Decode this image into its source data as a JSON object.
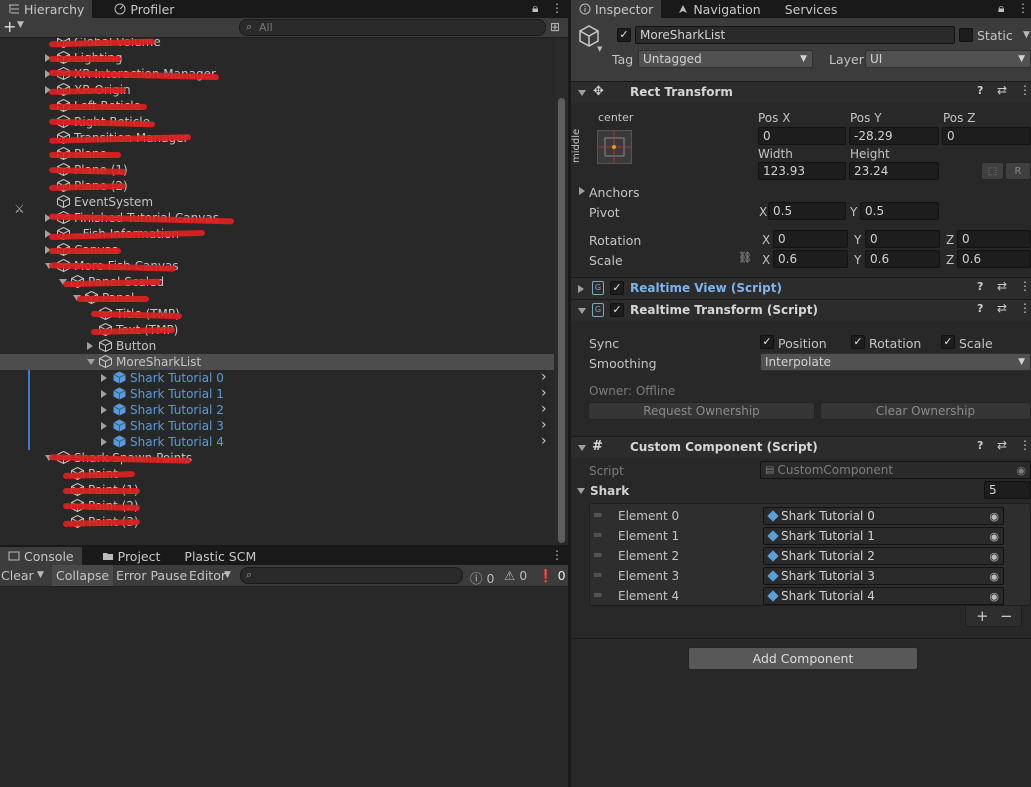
{
  "hierarchy": {
    "tabs": [
      "Hierarchy",
      "Profiler"
    ],
    "add_label": "+",
    "search_placeholder": "All",
    "items": [
      {
        "label": "Global Volume",
        "indent": 0,
        "arrow": "",
        "scratched": true
      },
      {
        "label": "Lighting",
        "indent": 0,
        "arrow": "right",
        "scratched": true
      },
      {
        "label": "XR Interaction Manager",
        "indent": 0,
        "arrow": "right",
        "scratched": true
      },
      {
        "label": "XR Origin",
        "indent": 0,
        "arrow": "right",
        "scratched": true
      },
      {
        "label": "Left Reticle",
        "indent": 0,
        "arrow": "",
        "scratched": true
      },
      {
        "label": "Right Reticle",
        "indent": 0,
        "arrow": "",
        "scratched": true
      },
      {
        "label": "Transition Manager",
        "indent": 0,
        "arrow": "",
        "scratched": true
      },
      {
        "label": "Plane",
        "indent": 0,
        "arrow": "",
        "scratched": true
      },
      {
        "label": "Plane (1)",
        "indent": 0,
        "arrow": "",
        "scratched": true
      },
      {
        "label": "Plane (2)",
        "indent": 0,
        "arrow": "",
        "scratched": true
      },
      {
        "label": "EventSystem",
        "indent": 0,
        "arrow": "",
        "scratched": false
      },
      {
        "label": "Finished Tutorial Canvas",
        "indent": 0,
        "arrow": "right",
        "scratched": true
      },
      {
        "label": "--Fish Information--",
        "indent": 0,
        "arrow": "right",
        "scratched": true
      },
      {
        "label": "Canvas",
        "indent": 0,
        "arrow": "right",
        "scratched": true
      },
      {
        "label": "More Fish Canvas",
        "indent": 0,
        "arrow": "down",
        "scratched": true
      },
      {
        "label": "Panel Scaled",
        "indent": 1,
        "arrow": "down",
        "scratched": true
      },
      {
        "label": "Panel",
        "indent": 2,
        "arrow": "down",
        "scratched": true
      },
      {
        "label": "Title (TMP)",
        "indent": 3,
        "arrow": "",
        "scratched": true
      },
      {
        "label": "Text (TMP)",
        "indent": 3,
        "arrow": "",
        "scratched": true
      },
      {
        "label": "Button",
        "indent": 3,
        "arrow": "right",
        "scratched": false
      },
      {
        "label": "MoreSharkList",
        "indent": 3,
        "arrow": "down",
        "scratched": false,
        "selected": true
      },
      {
        "label": "Shark Tutorial 0",
        "indent": 4,
        "arrow": "right",
        "scratched": false,
        "prefab": true
      },
      {
        "label": "Shark Tutorial 1",
        "indent": 4,
        "arrow": "right",
        "scratched": false,
        "prefab": true
      },
      {
        "label": "Shark Tutorial 2",
        "indent": 4,
        "arrow": "right",
        "scratched": false,
        "prefab": true
      },
      {
        "label": "Shark Tutorial 3",
        "indent": 4,
        "arrow": "right",
        "scratched": false,
        "prefab": true
      },
      {
        "label": "Shark Tutorial 4",
        "indent": 4,
        "arrow": "right",
        "scratched": false,
        "prefab": true
      },
      {
        "label": "Shark Spawn Points",
        "indent": 0,
        "arrow": "down",
        "scratched": true
      },
      {
        "label": "Point",
        "indent": 1,
        "arrow": "",
        "scratched": true
      },
      {
        "label": "Point (1)",
        "indent": 1,
        "arrow": "",
        "scratched": true
      },
      {
        "label": "Point (2)",
        "indent": 1,
        "arrow": "",
        "scratched": true
      },
      {
        "label": "Point (3)",
        "indent": 1,
        "arrow": "",
        "scratched": true
      }
    ]
  },
  "console": {
    "tabs": [
      "Console",
      "Project",
      "Plastic SCM"
    ],
    "toolbar": {
      "clear": "Clear",
      "collapse": "Collapse",
      "error_pause": "Error Pause",
      "editor": "Editor"
    },
    "counts": {
      "errors": "0",
      "warnings": "0",
      "infos": "0"
    }
  },
  "inspector": {
    "tabs": [
      "Inspector",
      "Navigation",
      "Services"
    ],
    "object": {
      "name": "MoreSharkList",
      "static_label": "Static",
      "tag_label": "Tag",
      "tag_value": "Untagged",
      "layer_label": "Layer",
      "layer_value": "UI"
    },
    "rect_transform": {
      "title": "Rect Transform",
      "anchor_preset_h": "center",
      "anchor_preset_v": "middle",
      "pos_x_label": "Pos X",
      "pos_y_label": "Pos Y",
      "pos_z_label": "Pos Z",
      "pos_x": "0",
      "pos_y": "-28.29",
      "pos_z": "0",
      "width_label": "Width",
      "height_label": "Height",
      "width": "123.93",
      "height": "23.24",
      "r_button": "R",
      "anchors_label": "Anchors",
      "pivot_label": "Pivot",
      "pivot_x": "0.5",
      "pivot_y": "0.5",
      "rotation_label": "Rotation",
      "rot_x": "0",
      "rot_y": "0",
      "rot_z": "0",
      "scale_label": "Scale",
      "scale_x": "0.6",
      "scale_y": "0.6",
      "scale_z": "0.6",
      "x": "X",
      "y": "Y",
      "z": "Z"
    },
    "realtime_view": {
      "title": "Realtime View (Script)"
    },
    "realtime_transform": {
      "title": "Realtime Transform (Script)",
      "sync_label": "Sync",
      "position": "Position",
      "rotation": "Rotation",
      "scale": "Scale",
      "smoothing_label": "Smoothing",
      "smoothing_value": "Interpolate",
      "owner": "Owner: Offline",
      "request_ownership": "Request Ownership",
      "clear_ownership": "Clear Ownership"
    },
    "custom_component": {
      "title": "Custom Component (Script)",
      "script_label": "Script",
      "script_value": "CustomComponent",
      "shark_label": "Shark",
      "shark_count": "5",
      "elements": [
        {
          "label": "Element 0",
          "value": "Shark Tutorial 0"
        },
        {
          "label": "Element 1",
          "value": "Shark Tutorial 1"
        },
        {
          "label": "Element 2",
          "value": "Shark Tutorial 2"
        },
        {
          "label": "Element 3",
          "value": "Shark Tutorial 3"
        },
        {
          "label": "Element 4",
          "value": "Shark Tutorial 4"
        }
      ],
      "add": "+",
      "remove": "−"
    },
    "add_component": "Add Component"
  },
  "colors": {
    "accent_blue": "#6aa8e8",
    "prefab_blue": "#5a9bd5",
    "scribble_red": "#e02020",
    "selected_row": "#4d4d4d"
  }
}
